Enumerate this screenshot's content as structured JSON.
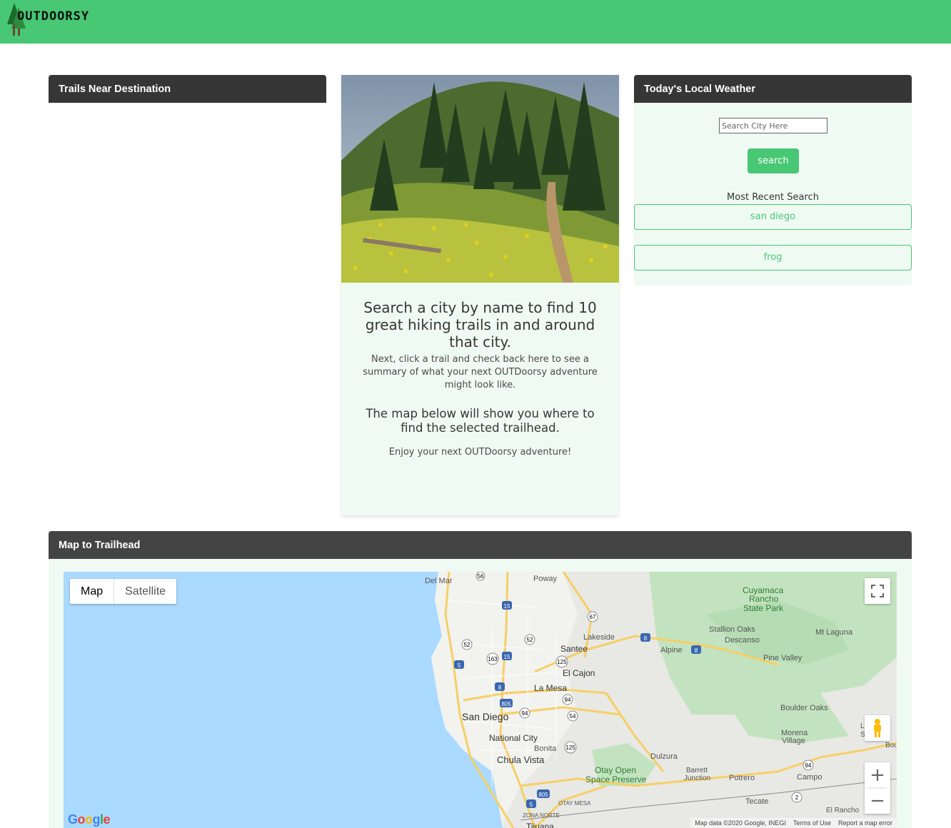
{
  "header": {
    "logo_text": "OUTDOORSY",
    "bg_color": "#48c774"
  },
  "trails_panel": {
    "title": "Trails Near Destination"
  },
  "hero": {
    "image": "forest-trail-wildflowers-photo",
    "title": "Search a city by name to find 10 great hiking trails in and around that city.",
    "subtitle": "Next, click a trail and check back here to see a summary of what your next OUTDoorsy adventure might look like.",
    "map_note": "The map below will show you where to find the selected trailhead.",
    "enjoy": "Enjoy your next OUTDoorsy adventure!"
  },
  "weather_panel": {
    "title": "Today's Local Weather",
    "search_placeholder": "Search City Here",
    "search_button": "search",
    "recent_label": "Most Recent Search",
    "recent_items": [
      "san diego",
      "frog"
    ]
  },
  "map_panel": {
    "title": "Map to Trailhead",
    "map_type_options": [
      "Map",
      "Satellite"
    ],
    "selected_map_type": "Map",
    "labels": {
      "del_mar": "Del Mar",
      "poway": "Poway",
      "cuyamaca": "Cuyamaca",
      "rancho": "Rancho",
      "state_park": "State Park",
      "lakeside": "Lakeside",
      "stallion_oaks": "Stallion Oaks",
      "descanso": "Descanso",
      "mt_laguna": "Mt Laguna",
      "santee": "Santee",
      "alpine": "Alpine",
      "pine_valley": "Pine Valley",
      "el_cajon": "El Cajon",
      "la_mesa": "La Mesa",
      "san_diego": "San Diego",
      "boulder_oaks": "Boulder Oaks",
      "national_city": "National City",
      "bonita": "Bonita",
      "morena": "Morena",
      "village": "Village",
      "chula_vista": "Chula Vista",
      "dulzura": "Dulzura",
      "otay_open": "Otay Open",
      "space_preserve": "Space Preserve",
      "barrett": "Barrett",
      "junction": "Junction",
      "potrero": "Potrero",
      "campo": "Campo",
      "otay_mesa": "OTAY MESA",
      "tecate": "Tecate",
      "zona_norte": "ZONA NORTE",
      "el_rancho": "El Rancho",
      "tijuana": "Tijuana",
      "edge_bou": "Bou",
      "edge_li": "Li",
      "edge_s": "S"
    },
    "highway_shields": [
      "56",
      "15",
      "67",
      "52",
      "8",
      "8",
      "52",
      "125",
      "163",
      "15",
      "5",
      "8",
      "805",
      "94",
      "94",
      "54",
      "125",
      "805",
      "5",
      "94",
      "2"
    ],
    "google_logo": "Google",
    "attribution": [
      "Map data ©2020 Google, INEGI",
      "Terms of Use",
      "Report a map error"
    ]
  }
}
